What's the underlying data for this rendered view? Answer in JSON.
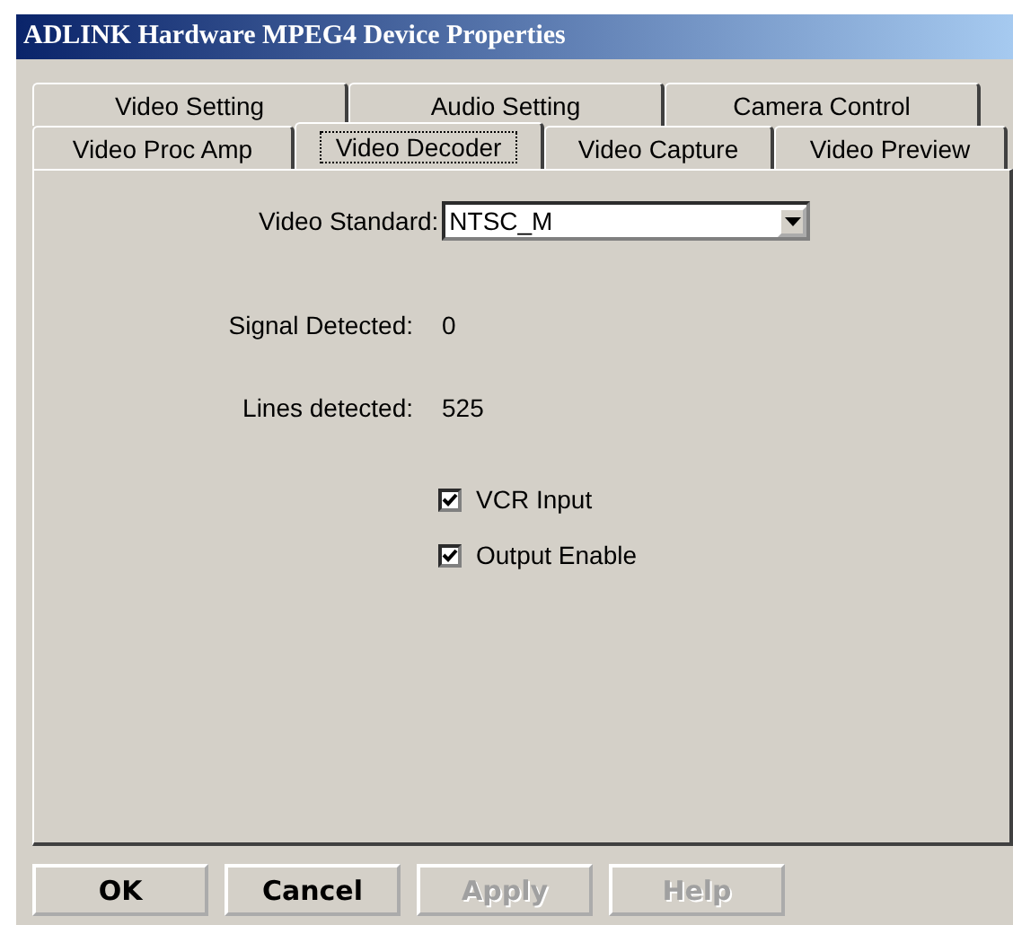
{
  "window": {
    "title": "ADLINK Hardware MPEG4 Device Properties"
  },
  "tab_rows": [
    [
      {
        "label": "Video Setting",
        "selected": false
      },
      {
        "label": "Audio Setting",
        "selected": false
      },
      {
        "label": "Camera Control",
        "selected": false
      }
    ],
    [
      {
        "label": "Video Proc Amp",
        "selected": false
      },
      {
        "label": "Video Decoder",
        "selected": true
      },
      {
        "label": "Video Capture",
        "selected": false
      },
      {
        "label": "Video Preview",
        "selected": false
      }
    ]
  ],
  "video_standard": {
    "label": "Video Standard:",
    "value": "NTSC_M"
  },
  "readouts": [
    {
      "label": "Signal Detected:",
      "value": "0"
    },
    {
      "label": "Lines detected:",
      "value": "525"
    }
  ],
  "checkboxes": [
    {
      "label": "VCR Input",
      "checked": true
    },
    {
      "label": "Output Enable",
      "checked": true
    }
  ],
  "buttons": [
    {
      "label": "OK",
      "disabled": false
    },
    {
      "label": "Cancel",
      "disabled": false
    },
    {
      "label": "Apply",
      "disabled": true
    },
    {
      "label": "Help",
      "disabled": true
    }
  ]
}
